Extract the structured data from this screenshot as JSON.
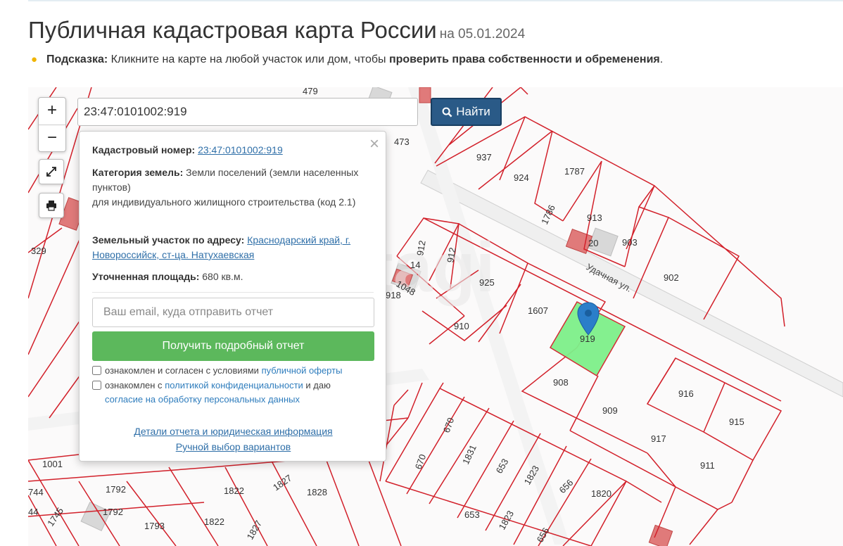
{
  "header": {
    "title": "Публичная кадастровая карта России",
    "date": "на 05.01.2024"
  },
  "hint": {
    "icon": "lightbulb-icon",
    "label": "Подсказка:",
    "text": "Кликните на карте на любой участок или дом, чтобы",
    "bold_text": "проверить права собственности и обременения",
    "end": "."
  },
  "search": {
    "value": "23:47:0101002:919",
    "button_label": "Найти",
    "button_icon": "search-icon"
  },
  "controls": {
    "zoom_in": "+",
    "zoom_out": "−",
    "fullscreen_icon": "fullscreen-icon",
    "print_icon": "print-icon"
  },
  "popup": {
    "close_glyph": "×",
    "cad_label": "Кадастровый номер:",
    "cad_value": "23:47:0101002:919",
    "category_label": "Категория земель:",
    "category_value": "Земли поселений (земли населенных пунктов)",
    "use_value": "для индивидуального жилищного строительства (код 2.1)",
    "address_label": "Земельный участок по адресу:",
    "address_value": "Краснодарский край, г. Новороссийск, ст-ца. Натухаевская",
    "area_label": "Уточненная площадь:",
    "area_value": "680 кв.м.",
    "email_placeholder": "Ваш email, куда отправить отчет",
    "report_button": "Получить подробный отчет",
    "consent1_text": "ознакомлен и согласен с условиями",
    "consent1_link": "публичной оферты",
    "consent2_text": "ознакомлен с",
    "consent2_link": "политикой конфиденциальности",
    "consent2_mid": "и даю",
    "consent2_link2": "согласие на обработку персональных данных",
    "details_link": "Детали отчета и юридическая информация",
    "manual_link": "Ручной выбор вариантов"
  },
  "map": {
    "street": "Удачная ул.",
    "selected_parcel": "919",
    "watermark": "etagi",
    "colors": {
      "boundary": "#d2202a",
      "selected": "#7ef08a",
      "marker": "#2b7ec9",
      "road": "#e6e6e6"
    },
    "parcels": [
      "479",
      "473",
      "937",
      "924",
      "1787",
      "1786",
      "913",
      "903",
      "902",
      "329",
      "912",
      "912",
      "14",
      "1048",
      "918",
      "925",
      "1607",
      "910",
      "919",
      "908",
      "916",
      "909",
      "915",
      "917",
      "911",
      "670",
      "670",
      "1831",
      "653",
      "1823",
      "656",
      "1820",
      "653",
      "1823",
      "656",
      "1001",
      "744",
      "1792",
      "1792",
      "1745",
      "1793",
      "1822",
      "1822",
      "1827",
      "1828",
      "1827",
      "44",
      "20"
    ]
  }
}
